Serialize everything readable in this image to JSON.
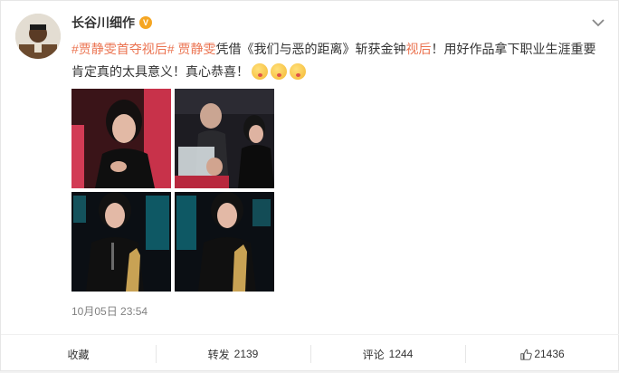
{
  "post": {
    "username": "长谷川细作",
    "verified_badge": "V",
    "hashtag1": "#贾静雯首夺视后#",
    "mention": "贾静雯",
    "text_a": "凭借《我们与恶的距离》斩获金钟",
    "link2": "视后",
    "text_b": "！用好作品拿下职业生涯重要肯定真的太具意义！真心恭喜！",
    "emoji_count": 3,
    "timestamp": "10月05日 23:54"
  },
  "actions": {
    "favorite_label": "收藏",
    "repost_label": "转发",
    "repost_count": "2139",
    "comment_label": "评论",
    "comment_count": "1244",
    "like_count": "21436"
  },
  "icons": {
    "menu": "chevron-down-icon",
    "like": "thumbs-up-icon",
    "emoji": "blush-kiss-emoji-icon"
  },
  "colors": {
    "link": "#eb7350",
    "badge": "#f5a623",
    "meta": "#808080"
  }
}
